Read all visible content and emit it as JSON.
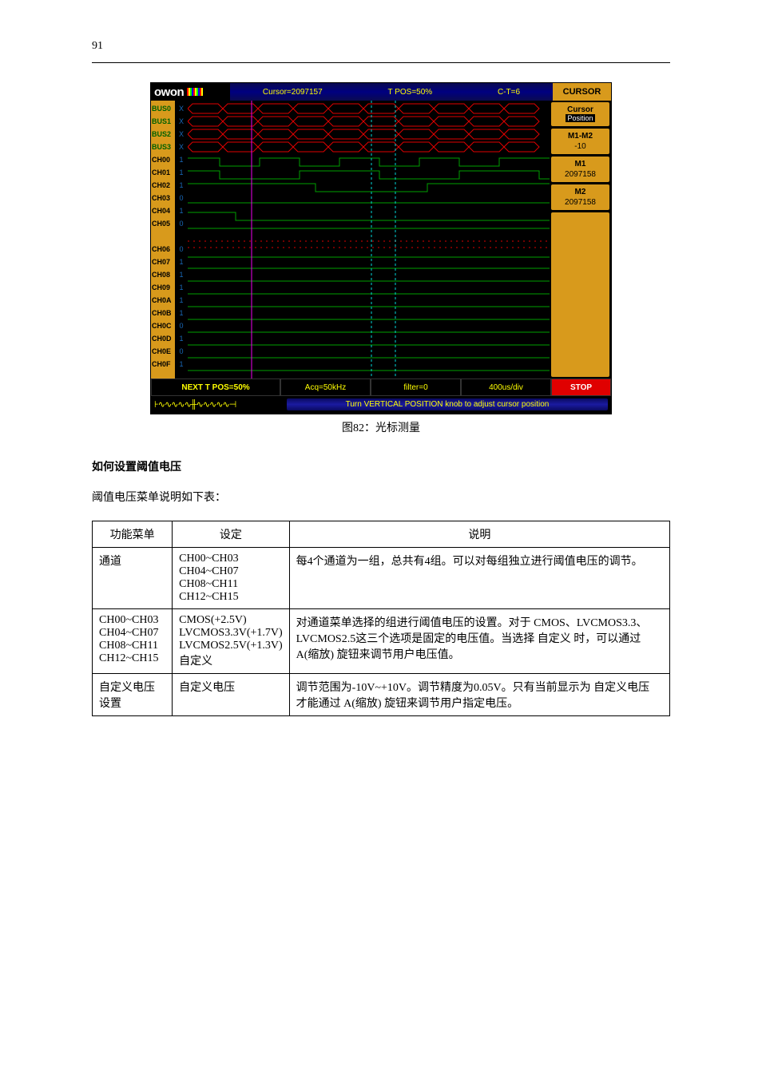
{
  "page_number": "91",
  "screenshot": {
    "brand": "owon",
    "top": {
      "cursor": "Cursor=2097157",
      "tpos": "T POS=50%",
      "ct": "C-T=6",
      "mode": "CURSOR"
    },
    "left_labels": [
      "BUS0",
      "BUS1",
      "BUS2",
      "BUS3",
      "CH00",
      "CH01",
      "CH02",
      "CH03",
      "CH04",
      "CH05",
      "",
      "CH06",
      "CH07",
      "CH08",
      "CH09",
      "CH0A",
      "CH0B",
      "CH0C",
      "CH0D",
      "CH0E",
      "CH0F"
    ],
    "left_values": [
      "X",
      "X",
      "X",
      "X",
      "1",
      "1",
      "1",
      "0",
      "1",
      "0",
      "",
      "0",
      "1",
      "1",
      "1",
      "1",
      "1",
      "0",
      "1",
      "0",
      "1"
    ],
    "right_panels": {
      "p1": {
        "line1": "Cursor",
        "line2": "Position"
      },
      "p2": {
        "title": "M1-M2",
        "value": "-10"
      },
      "p3": {
        "title": "M1",
        "value": "2097158"
      },
      "p4": {
        "title": "M2",
        "value": "2097158"
      }
    },
    "bottom": {
      "next": "NEXT T POS=50%",
      "acq": "Acq=50kHz",
      "filter": "filter=0",
      "div": "400us/div",
      "state": "STOP"
    },
    "status": "Turn VERTICAL POSITION knob to adjust cursor position"
  },
  "figure_caption": "图82：光标测量",
  "section_heading": "如何设置阈值电压",
  "section_intro": "阈值电压菜单说明如下表：",
  "table": {
    "headers": [
      "功能菜单",
      "设定",
      "说明"
    ],
    "rows": [
      [
        {
          "text": "通道"
        },
        {
          "text": "CH00~CH03\nCH04~CH07\nCH08~CH11\nCH12~CH15"
        },
        {
          "text": "每4个通道为一组，总共有4组。可以对每组独立进行阈值电压的调节。"
        }
      ],
      [
        {
          "text": "CH00~CH03\nCH04~CH07\nCH08~CH11\nCH12~CH15"
        },
        {
          "text": "CMOS(+2.5V)\nLVCMOS3.3V(+1.7V)\nLVCMOS2.5V(+1.3V)\n自定义"
        },
        {
          "text": "对通道菜单选择的组进行阈值电压的设置。对于 CMOS、LVCMOS3.3、LVCMOS2.5这三个选项是固定的电压值。当选择 自定义 时，可以通过 A(缩放) 旋钮来调节用户电压值。"
        }
      ],
      [
        {
          "text": "自定义电压设置"
        },
        {
          "text": "自定义电压"
        },
        {
          "text": "调节范围为-10V~+10V。调节精度为0.05V。只有当前显示为 自定义电压 才能通过 A(缩放) 旋钮来调节用户指定电压。"
        }
      ]
    ]
  }
}
